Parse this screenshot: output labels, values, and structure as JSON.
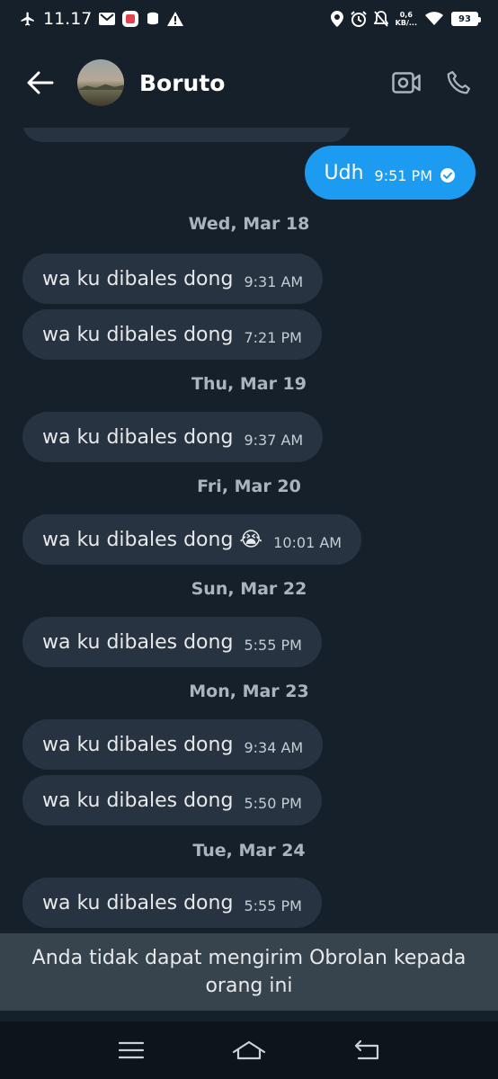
{
  "status_bar": {
    "time": "11.17",
    "net_speed_value": "0,6",
    "net_speed_unit": "KB/...",
    "battery": "93",
    "icons": [
      "airplane-icon",
      "gmail-icon",
      "app-notification-icon",
      "data-icon",
      "warning-icon",
      "location-icon",
      "alarm-icon",
      "mute-icon",
      "wifi-icon",
      "battery-icon"
    ]
  },
  "header": {
    "contact_name": "Boruto",
    "icons": [
      "back-arrow-icon",
      "video-call-icon",
      "phone-icon"
    ]
  },
  "messages": {
    "outgoing": {
      "text": "Udh",
      "time": "9:51 PM",
      "status_icon": "read-check-icon"
    },
    "groups": [
      {
        "date": "Wed, Mar 18",
        "items": [
          {
            "text": "wa ku dibales dong",
            "time": "9:31 AM"
          },
          {
            "text": "wa ku dibales dong",
            "time": "7:21 PM"
          }
        ]
      },
      {
        "date": "Thu, Mar 19",
        "items": [
          {
            "text": "wa ku dibales dong",
            "time": "9:37 AM"
          }
        ]
      },
      {
        "date": "Fri, Mar 20",
        "items": [
          {
            "text": "wa ku dibales dong 😭",
            "time": "10:01 AM"
          }
        ]
      },
      {
        "date": "Sun, Mar 22",
        "items": [
          {
            "text": "wa ku dibales dong",
            "time": "5:55 PM"
          }
        ]
      },
      {
        "date": "Mon, Mar 23",
        "items": [
          {
            "text": "wa ku dibales dong",
            "time": "9:34 AM"
          },
          {
            "text": "wa ku dibales dong",
            "time": "5:50 PM"
          }
        ]
      },
      {
        "date": "Tue, Mar 24",
        "items": [
          {
            "text": "wa ku dibales dong",
            "time": "5:55 PM"
          }
        ]
      }
    ]
  },
  "notice": {
    "text": "Anda tidak dapat mengirim Obrolan kepada orang ini"
  },
  "nav_bar": {
    "icons": [
      "menu-icon",
      "home-icon",
      "back-icon"
    ]
  },
  "colors": {
    "background": "#15202b",
    "incoming_bubble": "#273340",
    "outgoing_bubble": "#1d9bf0",
    "notice_bg": "#38444d"
  }
}
